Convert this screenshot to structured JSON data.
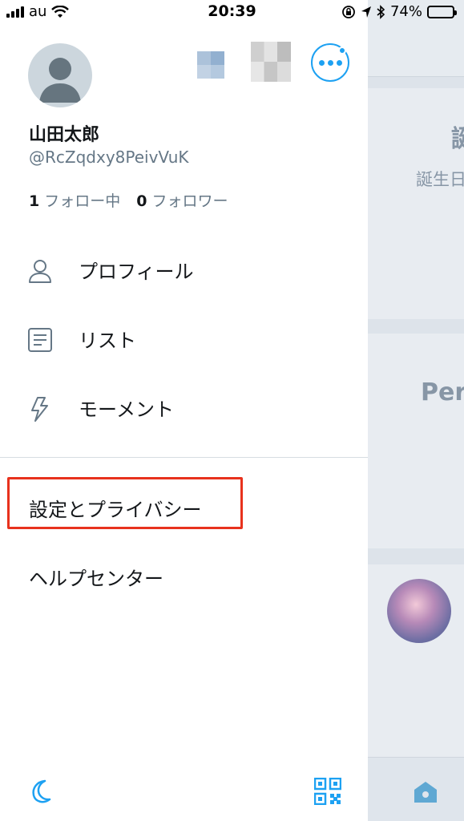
{
  "status_bar": {
    "carrier": "au",
    "time": "20:39",
    "battery_percent": "74%"
  },
  "profile": {
    "display_name": "山田太郎",
    "handle": "@RcZqdxy8PeivVuK",
    "following_count": "1",
    "following_label": "フォロー中",
    "followers_count": "0",
    "followers_label": "フォロワー"
  },
  "menu": {
    "profile_label": "プロフィール",
    "lists_label": "リスト",
    "moments_label": "モーメント",
    "settings_label": "設定とプライバシー",
    "help_label": "ヘルプセンター"
  },
  "background": {
    "heading_fragment": "誕",
    "subtext_fragment": "誕生日",
    "name_fragment": "Per"
  },
  "colors": {
    "accent": "#1da1f2",
    "highlight_border": "#e8321d",
    "secondary_text": "#657786"
  },
  "icons": {
    "profile": "person-icon",
    "lists": "list-icon",
    "moments": "lightning-icon",
    "night_mode": "moon-icon",
    "qr": "qr-code-icon",
    "more": "more-dots-icon",
    "home": "home-icon"
  }
}
